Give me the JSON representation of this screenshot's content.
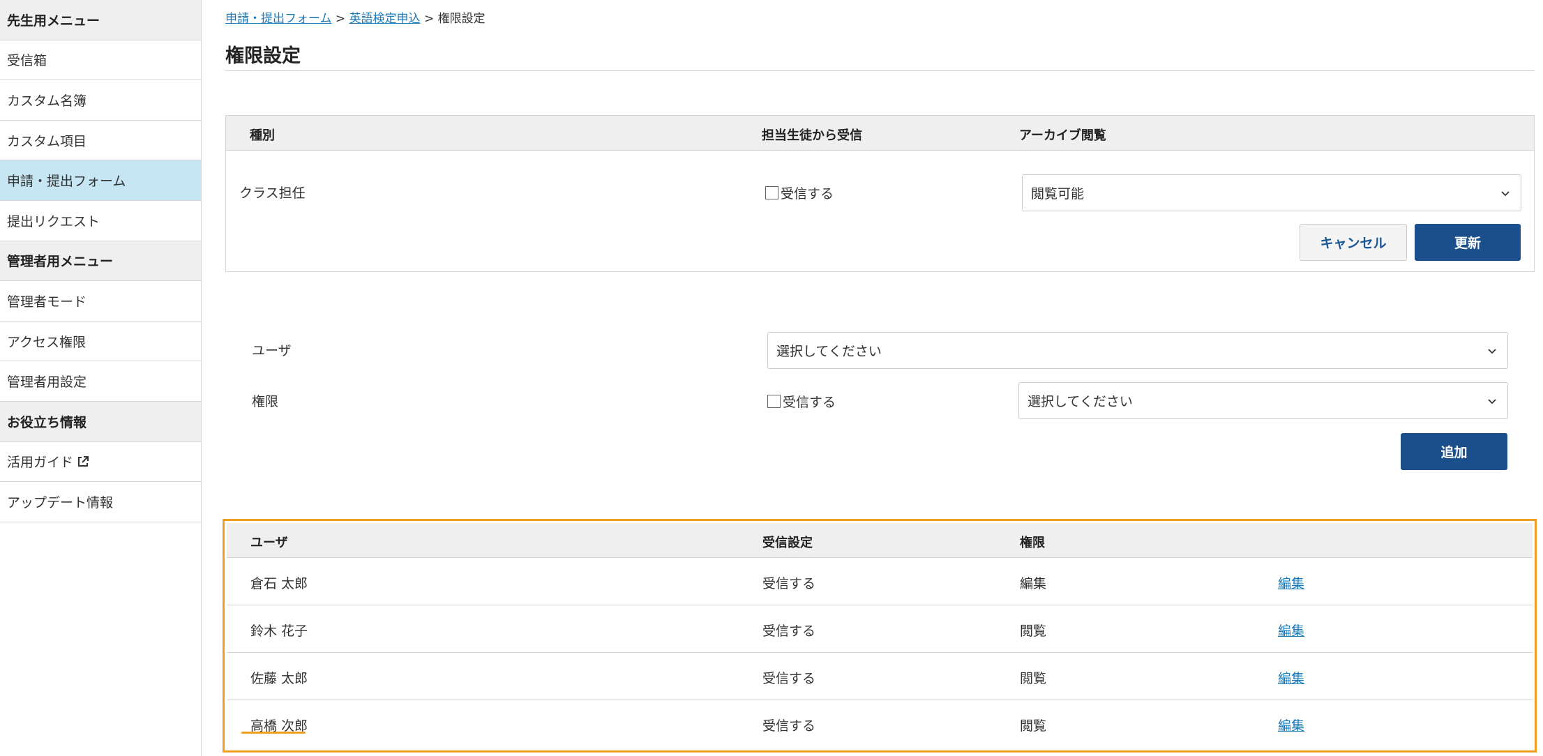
{
  "sidebar": {
    "items": [
      {
        "label": "先生用メニュー",
        "type": "header"
      },
      {
        "label": "受信箱",
        "type": "item"
      },
      {
        "label": "カスタム名簿",
        "type": "item"
      },
      {
        "label": "カスタム項目",
        "type": "item"
      },
      {
        "label": "申請・提出フォーム",
        "type": "item",
        "active": true
      },
      {
        "label": "提出リクエスト",
        "type": "item"
      },
      {
        "label": "管理者用メニュー",
        "type": "header"
      },
      {
        "label": "管理者モード",
        "type": "item"
      },
      {
        "label": "アクセス権限",
        "type": "item"
      },
      {
        "label": "管理者用設定",
        "type": "item"
      },
      {
        "label": "お役立ち情報",
        "type": "header"
      },
      {
        "label": "活用ガイド",
        "type": "item",
        "icon": "external-link-icon"
      },
      {
        "label": "アップデート情報",
        "type": "item"
      }
    ]
  },
  "breadcrumb": {
    "items": [
      "申請・提出フォーム",
      "英語検定申込",
      "権限設定"
    ],
    "separator": ">"
  },
  "page_title": "権限設定",
  "type_table": {
    "headers": [
      "種別",
      "担当生徒から受信",
      "アーカイブ閲覧"
    ],
    "row": {
      "type": "クラス担任",
      "receive_label": "受信する",
      "receive_checked": false,
      "archive_value": "閲覧可能"
    },
    "cancel_label": "キャンセル",
    "update_label": "更新"
  },
  "add_form": {
    "user_label": "ユーザ",
    "user_select": "選択してください",
    "permission_label": "権限",
    "receive_label": "受信する",
    "receive_checked": false,
    "permission_select": "選択してください",
    "add_label": "追加"
  },
  "users_table": {
    "headers": [
      "ユーザ",
      "受信設定",
      "権限",
      ""
    ],
    "rows": [
      {
        "name": "倉石 太郎",
        "receive": "受信する",
        "permission": "編集",
        "action": "編集"
      },
      {
        "name": "鈴木 花子",
        "receive": "受信する",
        "permission": "閲覧",
        "action": "編集"
      },
      {
        "name": "佐藤 太郎",
        "receive": "受信する",
        "permission": "閲覧",
        "action": "編集"
      },
      {
        "name": "高橋 次郎",
        "receive": "受信する",
        "permission": "閲覧",
        "action": "編集"
      }
    ]
  },
  "colors": {
    "accent": "#1a4f8b",
    "link": "#1a7ab8",
    "active_menu": "#c6e6f3",
    "highlight": "#f0a020"
  }
}
